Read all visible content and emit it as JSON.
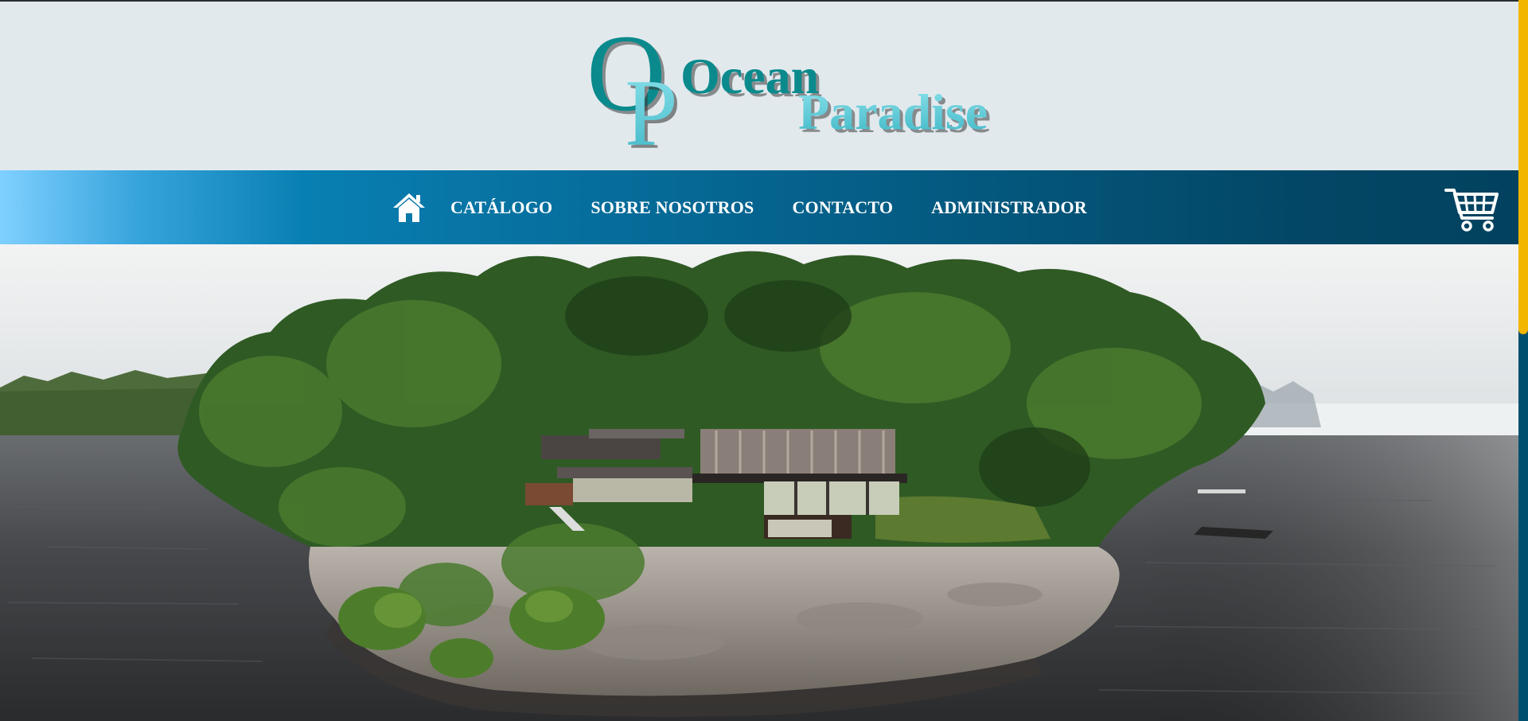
{
  "brand": {
    "monogram": "OP",
    "name_line1": "Ocean",
    "name_line2": "Paradise",
    "colors": {
      "teal_dark": "#0a8a8c",
      "teal_light": "#55c9d6",
      "shadow": "#4a4a4a"
    }
  },
  "nav": {
    "home_icon": "home-icon",
    "items": [
      {
        "label": "CATÁLOGO"
      },
      {
        "label": "SOBRE NOSOTROS"
      },
      {
        "label": "CONTACTO"
      },
      {
        "label": "ADMINISTRADOR"
      }
    ],
    "cart_icon": "shopping-cart-icon",
    "colors": {
      "gradient_start": "#7fd0ff",
      "gradient_end": "#02425f",
      "text": "#ffffff"
    }
  },
  "hero": {
    "image": "island-house-photo",
    "colors": {
      "water": "#3c3c3e",
      "sky": "#eef1f2",
      "forest": "#2f5a24"
    }
  },
  "scrollbar": {
    "track_color": "#004f6e",
    "thumb_color": "#f2b600"
  }
}
